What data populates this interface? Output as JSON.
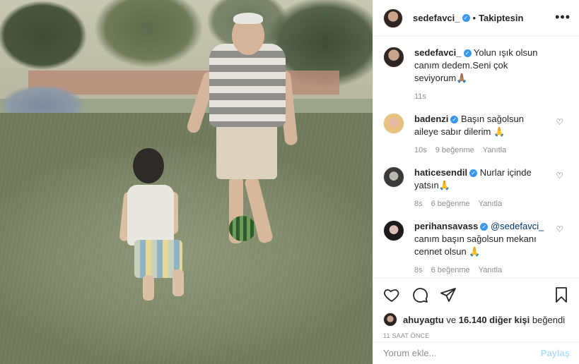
{
  "post": {
    "author": "sedefavci_",
    "follow_status": "Takiptesin",
    "dot": "•",
    "more_label": "•••"
  },
  "caption": {
    "user": "sedefavci_",
    "text": "Yolun ışık olsun canım dedem.Seni çok seviyorum🙏🏽",
    "time": "11s"
  },
  "comments": [
    {
      "user": "badenzi",
      "text": "Başın sağolsun aileye sabır dilerim 🙏",
      "time": "10s",
      "likes": "9 beğenme",
      "reply": "Yanıtla"
    },
    {
      "user": "haticesendil",
      "text": "Nurlar içinde yatsın🙏",
      "time": "8s",
      "likes": "6 beğenme",
      "reply": "Yanıtla"
    },
    {
      "user": "perihansavass",
      "mention": "@sedefavci_",
      "text": "canım başın sağolsun mekanı cennet olsun 🙏",
      "time": "8s",
      "likes": "6 beğenme",
      "reply": "Yanıtla"
    }
  ],
  "likes": {
    "user": "ahuyagtu",
    "connector": "ve",
    "others": "16.140 diğer kişi",
    "suffix": "beğendi"
  },
  "timestamp": "11 SAAT ÖNCE",
  "composer": {
    "placeholder": "Yorum ekle...",
    "post_label": "Paylaş"
  },
  "icons": {
    "like": "heart-icon",
    "comment": "comment-icon",
    "share": "share-icon",
    "save": "bookmark-icon",
    "more": "more-icon",
    "verified": "verified-icon"
  },
  "colors": {
    "verified": "#3897f0",
    "text": "#262626",
    "muted": "#8e8e8e",
    "post_disabled": "#b2dffc"
  }
}
